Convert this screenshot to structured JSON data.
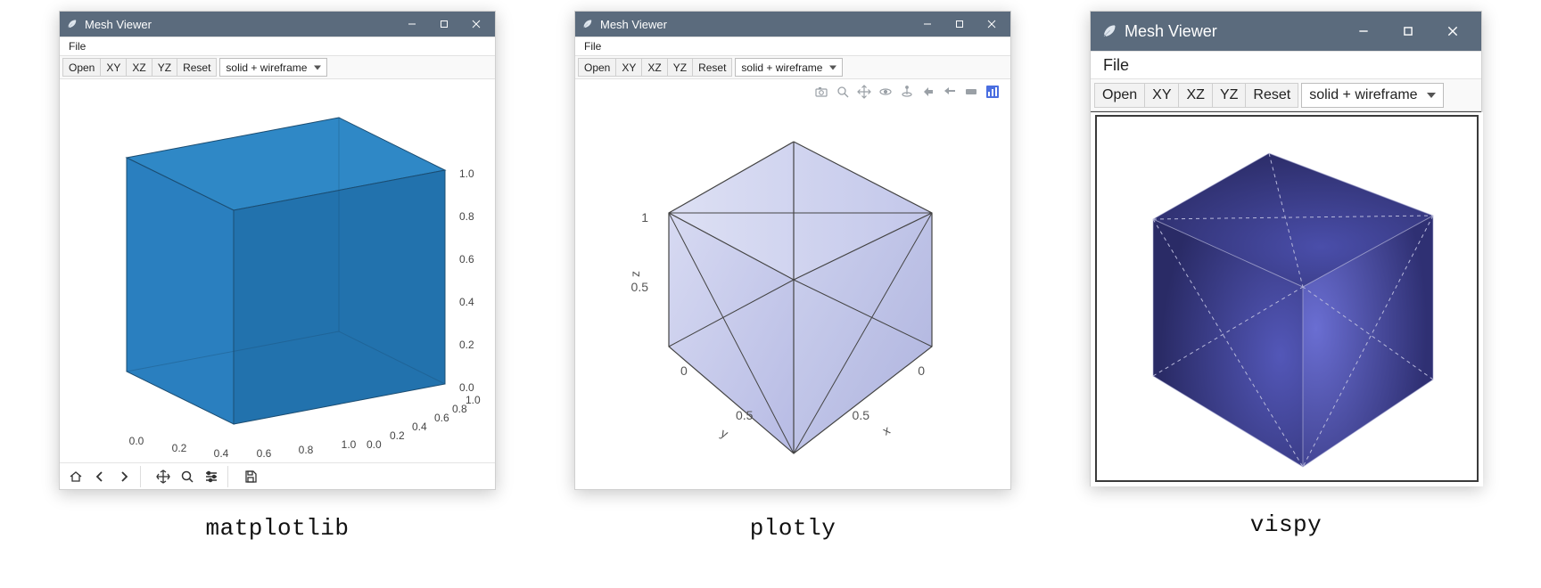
{
  "windows": [
    {
      "title": "Mesh Viewer",
      "kind": "matplotlib",
      "menus": [
        "File"
      ],
      "toolbar": {
        "buttons": [
          "Open",
          "XY",
          "XZ",
          "YZ",
          "Reset"
        ],
        "dropdown": "solid + wireframe"
      },
      "mpl_toolbar_icons": [
        "home-icon",
        "back-icon",
        "forward-icon",
        "pan-icon",
        "zoom-icon",
        "configure-icon",
        "save-icon"
      ],
      "axes": {
        "x_ticks": [
          "0.0",
          "0.2",
          "0.4",
          "0.6",
          "0.8",
          "1.0"
        ],
        "y_ticks": [
          "0.0",
          "0.2",
          "0.4",
          "0.6",
          "0.8",
          "1.0"
        ],
        "z_ticks": [
          "0.0",
          "0.2",
          "0.4",
          "0.6",
          "0.8",
          "1.0"
        ]
      },
      "caption": "matplotlib"
    },
    {
      "title": "Mesh Viewer",
      "kind": "plotly",
      "menus": [
        "File"
      ],
      "toolbar": {
        "buttons": [
          "Open",
          "XY",
          "XZ",
          "YZ",
          "Reset"
        ],
        "dropdown": "solid + wireframe"
      },
      "modebar_icons": [
        "camera-icon",
        "zoom-icon",
        "pan-icon",
        "orbit-icon",
        "turntable-icon",
        "reset-camera-icon",
        "reset-last-icon",
        "toggle-spike-icon",
        "plotly-logo-icon"
      ],
      "axes": {
        "x_label": "x",
        "y_label": "y",
        "z_label": "z",
        "x_ticks": [
          "0",
          "0.5"
        ],
        "y_ticks": [
          "0",
          "0.5"
        ],
        "z_ticks": [
          "0.5",
          "1"
        ]
      },
      "caption": "plotly"
    },
    {
      "title": "Mesh Viewer",
      "kind": "vispy",
      "menus": [
        "File"
      ],
      "toolbar": {
        "buttons": [
          "Open",
          "XY",
          "XZ",
          "YZ",
          "Reset"
        ],
        "dropdown": "solid + wireframe"
      },
      "caption": "vispy"
    }
  ],
  "chart_data": [
    {
      "type": "mesh3d",
      "object": "unit-cube",
      "library": "matplotlib",
      "vertices": [
        [
          0,
          0,
          0
        ],
        [
          1,
          0,
          0
        ],
        [
          1,
          1,
          0
        ],
        [
          0,
          1,
          0
        ],
        [
          0,
          0,
          1
        ],
        [
          1,
          0,
          1
        ],
        [
          1,
          1,
          1
        ],
        [
          0,
          1,
          1
        ]
      ],
      "faces_quads": [
        [
          0,
          1,
          2,
          3
        ],
        [
          4,
          5,
          6,
          7
        ],
        [
          0,
          1,
          5,
          4
        ],
        [
          1,
          2,
          6,
          5
        ],
        [
          2,
          3,
          7,
          6
        ],
        [
          3,
          0,
          4,
          7
        ]
      ],
      "mode": "solid + wireframe",
      "xlabel": "",
      "ylabel": "",
      "zlabel": "",
      "xlim": [
        0,
        1
      ],
      "ylim": [
        0,
        1
      ],
      "zlim": [
        0,
        1
      ],
      "x_ticks": [
        0.0,
        0.2,
        0.4,
        0.6,
        0.8,
        1.0
      ],
      "y_ticks": [
        0.0,
        0.2,
        0.4,
        0.6,
        0.8,
        1.0
      ],
      "z_ticks": [
        0.0,
        0.2,
        0.4,
        0.6,
        0.8,
        1.0
      ],
      "face_color": "#2a7fbf",
      "edge_color": "#184b6e"
    },
    {
      "type": "mesh3d",
      "object": "unit-cube",
      "library": "plotly",
      "vertices": [
        [
          0,
          0,
          0
        ],
        [
          1,
          0,
          0
        ],
        [
          1,
          1,
          0
        ],
        [
          0,
          1,
          0
        ],
        [
          0,
          0,
          1
        ],
        [
          1,
          0,
          1
        ],
        [
          1,
          1,
          1
        ],
        [
          0,
          1,
          1
        ]
      ],
      "faces_tris": [
        [
          0,
          1,
          2
        ],
        [
          0,
          2,
          3
        ],
        [
          4,
          5,
          6
        ],
        [
          4,
          6,
          7
        ],
        [
          0,
          1,
          5
        ],
        [
          0,
          5,
          4
        ],
        [
          1,
          2,
          6
        ],
        [
          1,
          6,
          5
        ],
        [
          2,
          3,
          7
        ],
        [
          2,
          7,
          6
        ],
        [
          3,
          0,
          4
        ],
        [
          3,
          4,
          7
        ]
      ],
      "mode": "solid + wireframe",
      "xlabel": "x",
      "ylabel": "y",
      "zlabel": "z",
      "xlim": [
        0,
        1
      ],
      "ylim": [
        0,
        1
      ],
      "zlim": [
        0,
        1
      ],
      "x_ticks": [
        0,
        0.5
      ],
      "y_ticks": [
        0,
        0.5
      ],
      "z_ticks": [
        0.5,
        1
      ],
      "face_color": "#c6caee",
      "edge_color": "#444444"
    },
    {
      "type": "mesh3d",
      "object": "unit-cube",
      "library": "vispy",
      "vertices": [
        [
          0,
          0,
          0
        ],
        [
          1,
          0,
          0
        ],
        [
          1,
          1,
          0
        ],
        [
          0,
          1,
          0
        ],
        [
          0,
          0,
          1
        ],
        [
          1,
          0,
          1
        ],
        [
          1,
          1,
          1
        ],
        [
          0,
          1,
          1
        ]
      ],
      "faces_tris": [
        [
          0,
          1,
          2
        ],
        [
          0,
          2,
          3
        ],
        [
          4,
          5,
          6
        ],
        [
          4,
          6,
          7
        ],
        [
          0,
          1,
          5
        ],
        [
          0,
          5,
          4
        ],
        [
          1,
          2,
          6
        ],
        [
          1,
          6,
          5
        ],
        [
          2,
          3,
          7
        ],
        [
          2,
          7,
          6
        ],
        [
          3,
          0,
          4
        ],
        [
          3,
          4,
          7
        ]
      ],
      "mode": "solid + wireframe",
      "face_color": "#3a3c8a",
      "edge_color": "#b8badf",
      "edge_style": "dashed"
    }
  ]
}
